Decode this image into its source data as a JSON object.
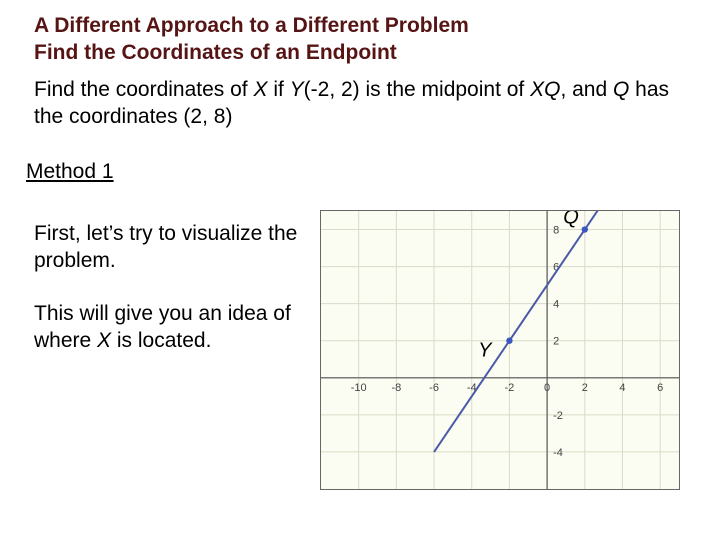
{
  "heading1": "A Different Approach to a Different Problem",
  "heading2": "Find the Coordinates of an Endpoint",
  "problem": {
    "prefix": "Find the coordinates of ",
    "X": "X",
    "mid1": " if ",
    "Y": "Y",
    "ycoord": "(-2, 2) is the midpoint of ",
    "XQ": "XQ",
    "mid2": ", and ",
    "Q": "Q",
    "suffix": " has the coordinates (2, 8)"
  },
  "method": "Method 1",
  "p1": "First, let’s try to visualize the problem.",
  "p2": {
    "a": "This will give you an idea of where ",
    "X": "X",
    "b": " is located."
  },
  "chart_data": {
    "type": "line",
    "xlabel": "",
    "ylabel": "",
    "xlim": [
      -12,
      7
    ],
    "ylim": [
      -6,
      9
    ],
    "x_ticks": [
      -10,
      -8,
      -6,
      -4,
      -2,
      0,
      2,
      4,
      6
    ],
    "y_ticks": [
      -4,
      -2,
      0,
      2,
      4,
      6,
      8
    ],
    "series": [
      {
        "name": "segment",
        "x": [
          -6,
          4
        ],
        "y": [
          -4,
          11
        ]
      }
    ],
    "points": [
      {
        "name": "Y",
        "x": -2,
        "y": 2
      },
      {
        "name": "Q",
        "x": 2,
        "y": 8
      }
    ]
  }
}
